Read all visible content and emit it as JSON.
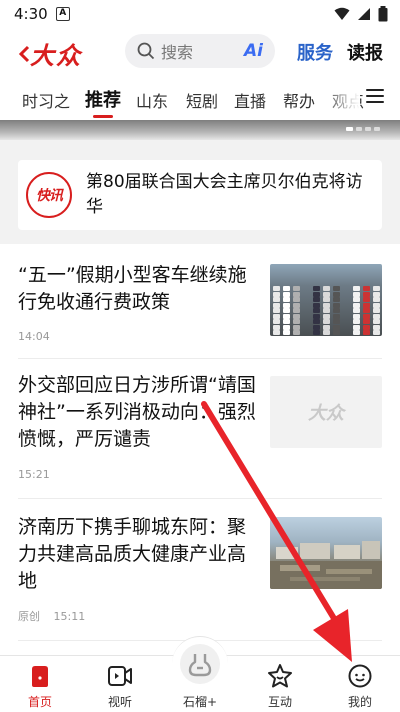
{
  "status_bar": {
    "time": "4:30",
    "notif_icon": "A"
  },
  "header": {
    "logo_text": "大众",
    "search_placeholder": "搜索",
    "ai_badge": "Ai",
    "service_label": "服务",
    "read_label": "读报",
    "brand_color": "#d81e1e",
    "service_color": "#2a63c9"
  },
  "tabs": [
    {
      "label": "时习之"
    },
    {
      "label": "推荐",
      "active": true
    },
    {
      "label": "山东"
    },
    {
      "label": "短剧"
    },
    {
      "label": "直播"
    },
    {
      "label": "帮办"
    },
    {
      "label": "观点"
    }
  ],
  "flash_news": {
    "badge": "快讯",
    "text": "第80届联合国大会主席贝尔伯克将访华"
  },
  "news": [
    {
      "title": "“五一”假期小型客车继续施行免收通行费政策",
      "source": "",
      "time": "14:04",
      "thumb": "traffic"
    },
    {
      "title": "外交部回应日方涉所谓“靖国神社”一系列消极动向：强烈愤慨，严厉谴责",
      "source": "",
      "time": "15:21",
      "thumb": "logo",
      "thumb_text": "大众"
    },
    {
      "title": "济南历下携手聊城东阿：聚力共建高品质大健康产业高地",
      "source": "原创",
      "time": "15:11",
      "thumb": "construction"
    }
  ],
  "bottom_nav": [
    {
      "label": "首页",
      "icon": "home-icon",
      "active": true
    },
    {
      "label": "视听",
      "icon": "video-icon"
    },
    {
      "label": "石榴+",
      "icon": "pomegranate-icon"
    },
    {
      "label": "互动",
      "icon": "star-chat-icon"
    },
    {
      "label": "我的",
      "icon": "profile-icon"
    }
  ],
  "annotation_arrow": {
    "color": "#e8242a",
    "target": "我的"
  }
}
